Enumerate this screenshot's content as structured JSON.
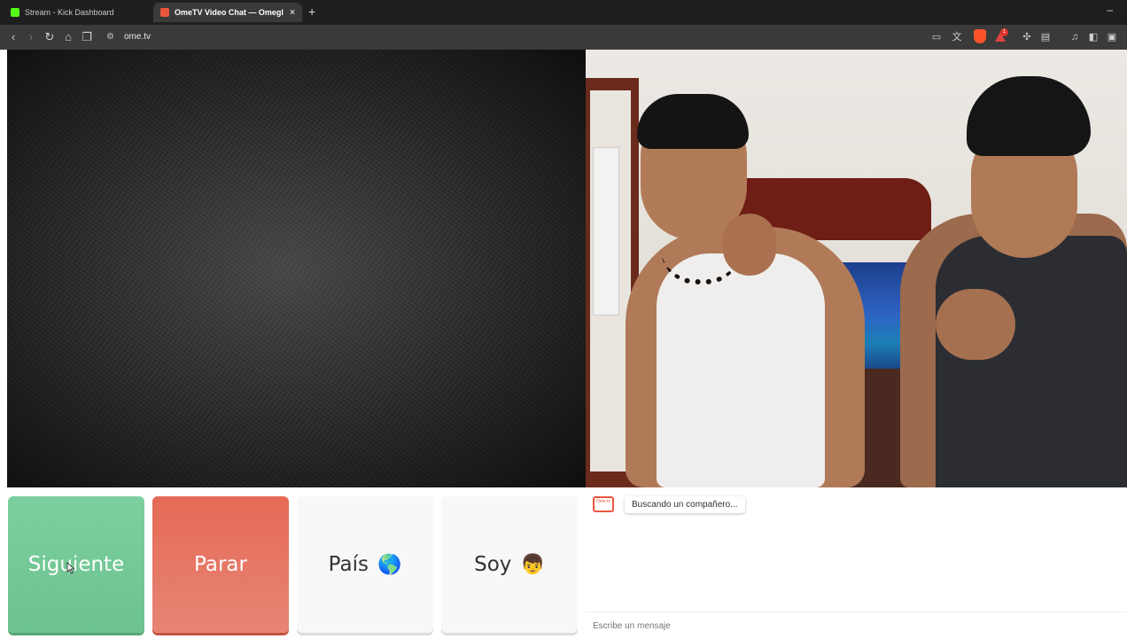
{
  "browser": {
    "tabs": [
      {
        "title": "Stream - Kick Dashboard",
        "favicon_color": "#53fc18",
        "active": false
      },
      {
        "title": "OmeTV Video Chat — Omegl",
        "favicon_color": "#e8573d",
        "active": true
      }
    ],
    "tab_close_glyph": "×",
    "new_tab_glyph": "+",
    "minimize_glyph": "–",
    "url": "ome.tv",
    "nav": {
      "back": "‹",
      "forward": "›",
      "reload": "↻",
      "home": "⌂",
      "bookmark": "❐"
    },
    "brave_badge": "1"
  },
  "controls": {
    "next_label": "Siguiente",
    "stop_label": "Parar",
    "country_label": "País",
    "country_emoji": "🌎",
    "gender_label": "Soy",
    "gender_emoji": "👦"
  },
  "chat": {
    "logo_text": "Ome tv",
    "status_message": "Buscando un compañero...",
    "input_placeholder": "Escribe un mensaje"
  },
  "colors": {
    "next_button": "#6cc38f",
    "stop_button": "#e56a55",
    "brand": "#e8573d"
  }
}
